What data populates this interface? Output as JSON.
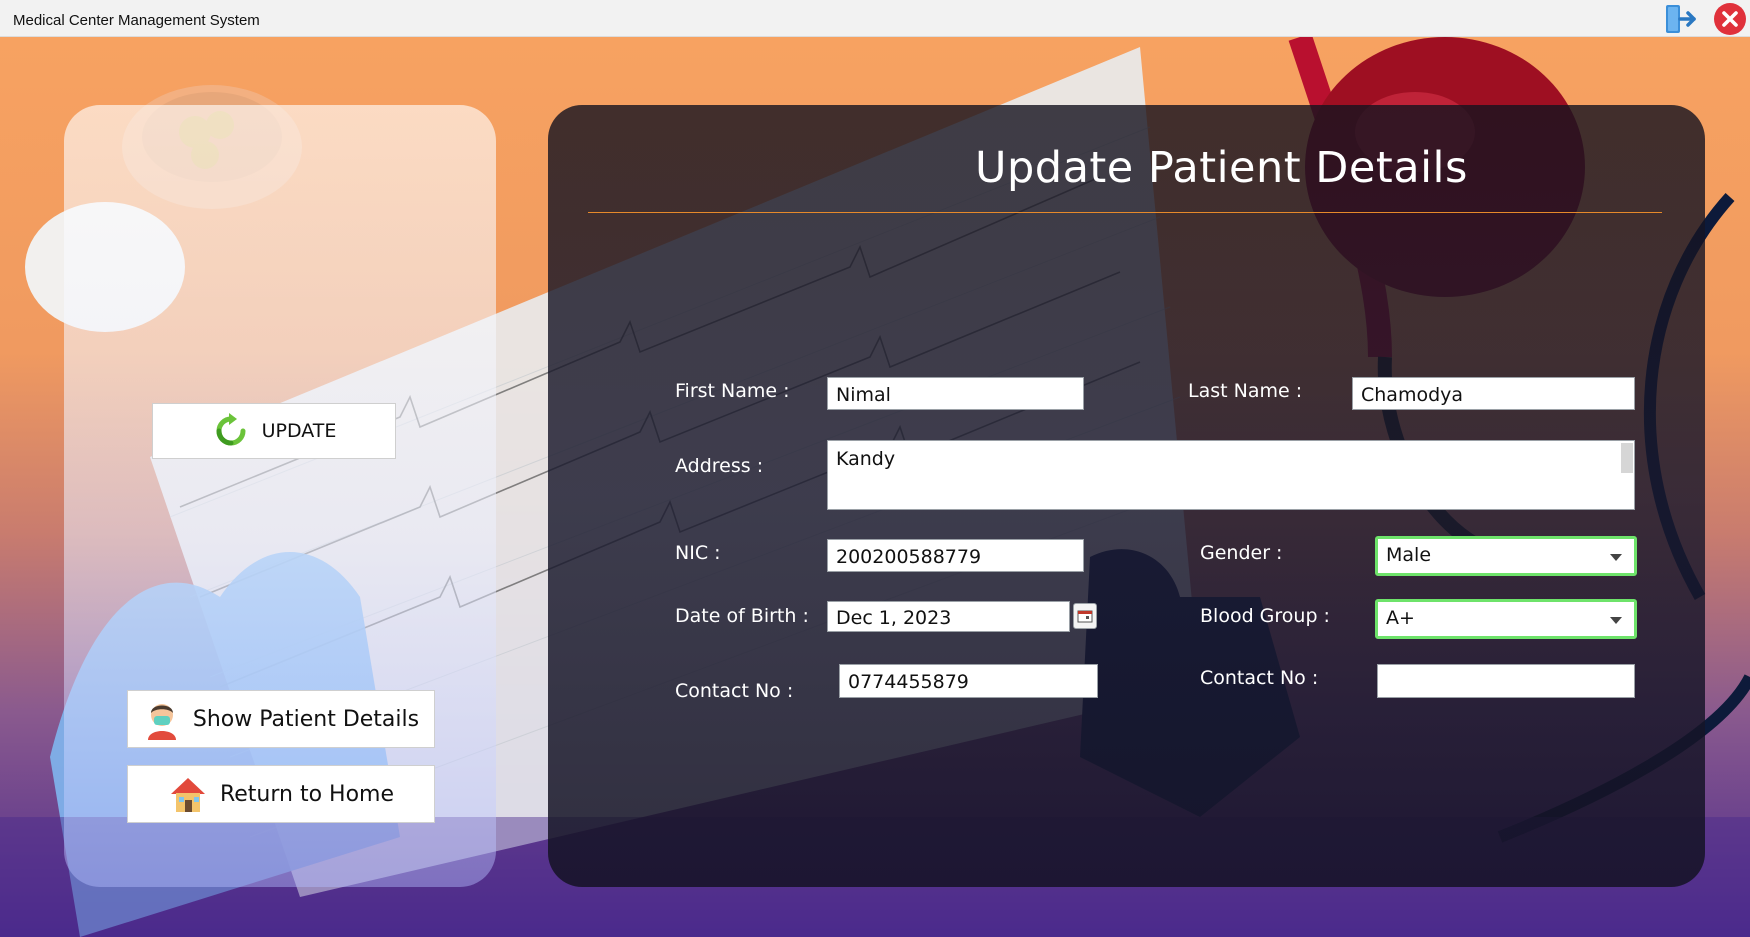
{
  "window": {
    "title": "Medical Center Management System"
  },
  "left_panel": {
    "update_label": "UPDATE",
    "show_label": "Show Patient Details",
    "home_label": "Return to Home"
  },
  "form": {
    "title": "Update Patient Details",
    "first_name": {
      "label": "First Name  :",
      "value": "Nimal"
    },
    "last_name": {
      "label": "Last Name  :",
      "value": "Chamodya"
    },
    "address": {
      "label": "Address  :",
      "value": "Kandy"
    },
    "nic": {
      "label": "NIC  :",
      "value": "200200588779"
    },
    "gender": {
      "label": "Gender  :",
      "value": "Male"
    },
    "dob": {
      "label": "Date of Birth  :",
      "value": "Dec 1, 2023"
    },
    "blood_group": {
      "label": "Blood Group  :",
      "value": "A+"
    },
    "contact1": {
      "label": "Contact No  :",
      "value": "0774455879"
    },
    "contact2": {
      "label": "Contact No  :",
      "value": ""
    }
  },
  "colors": {
    "accent_rule": "#e6892a",
    "combo_border": "#6ee36a",
    "close_red": "#e0313b"
  },
  "icons": {
    "logout": "logout-icon",
    "close": "close-icon",
    "update": "refresh-icon",
    "patient": "patient-icon",
    "home": "home-icon",
    "calendar": "calendar-icon"
  }
}
